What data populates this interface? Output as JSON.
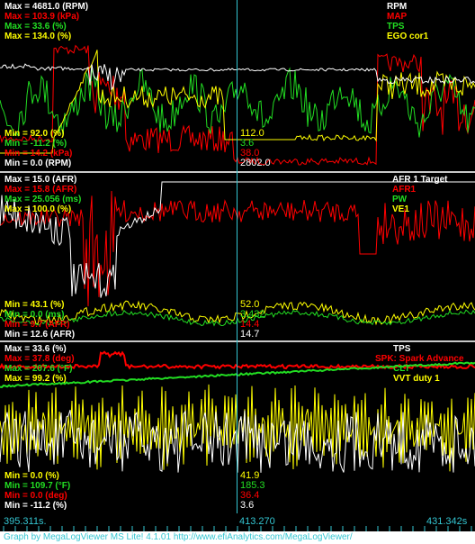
{
  "colors": {
    "white": "#ffffff",
    "red": "#ff0000",
    "green": "#22dd22",
    "yellow": "#ffff00",
    "cyan": "#34c6d2",
    "divider": "#c8c8c8"
  },
  "panel1": {
    "max_labels": [
      {
        "text": "Max = 4681.0 (RPM)",
        "color": "white"
      },
      {
        "text": "Max = 103.9 (kPa)",
        "color": "red"
      },
      {
        "text": "Max = 33.6 (%)",
        "color": "green"
      },
      {
        "text": "Max = 134.0 (%)",
        "color": "yellow"
      }
    ],
    "legend": [
      {
        "text": "RPM",
        "color": "white"
      },
      {
        "text": "MAP",
        "color": "red"
      },
      {
        "text": "TPS",
        "color": "green"
      },
      {
        "text": "EGO cor1",
        "color": "yellow"
      }
    ],
    "min_labels": [
      {
        "text": "Min = 92.0 (%)",
        "color": "yellow"
      },
      {
        "text": "Min = -11.2 (%)",
        "color": "green"
      },
      {
        "text": "Min = 14.2 (kPa)",
        "color": "red"
      },
      {
        "text": "Min = 0.0 (RPM)",
        "color": "white"
      }
    ],
    "cursor_values": [
      {
        "text": "112.0",
        "color": "yellow"
      },
      {
        "text": "3.6",
        "color": "green"
      },
      {
        "text": "38.0",
        "color": "red"
      },
      {
        "text": "2802.0",
        "color": "white"
      }
    ]
  },
  "panel2": {
    "max_labels": [
      {
        "text": "Max = 15.0 (AFR)",
        "color": "white"
      },
      {
        "text": "Max = 15.8 (AFR)",
        "color": "red"
      },
      {
        "text": "Max = 25.056 (ms)",
        "color": "green"
      },
      {
        "text": "Max = 100.0 (%)",
        "color": "yellow"
      }
    ],
    "legend": [
      {
        "text": "AFR 1 Target",
        "color": "white"
      },
      {
        "text": "AFR1",
        "color": "red"
      },
      {
        "text": "PW",
        "color": "green"
      },
      {
        "text": "VE1",
        "color": "yellow"
      }
    ],
    "min_labels": [
      {
        "text": "Min = 43.1 (%)",
        "color": "yellow"
      },
      {
        "text": "Min = 0.0 (ms)",
        "color": "green"
      },
      {
        "text": "Min = 9.7 (AFR)",
        "color": "red"
      },
      {
        "text": "Min = 12.6 (AFR)",
        "color": "white"
      }
    ],
    "cursor_values": [
      {
        "text": "52.0",
        "color": "yellow"
      },
      {
        "text": "3.432",
        "color": "green"
      },
      {
        "text": "14.4",
        "color": "red"
      },
      {
        "text": "14.7",
        "color": "white"
      }
    ]
  },
  "panel3": {
    "max_labels": [
      {
        "text": "Max = 33.6 (%)",
        "color": "white"
      },
      {
        "text": "Max = 37.8 (deg)",
        "color": "red"
      },
      {
        "text": "Max = 207.6 (°F)",
        "color": "green"
      },
      {
        "text": "Max = 99.2 (%)",
        "color": "yellow"
      }
    ],
    "legend": [
      {
        "text": "TPS",
        "color": "white"
      },
      {
        "text": "SPK: Spark Advance",
        "color": "red"
      },
      {
        "text": "CLT",
        "color": "green"
      },
      {
        "text": "VVT duty 1",
        "color": "yellow"
      }
    ],
    "min_labels": [
      {
        "text": "Min = 0.0 (%)",
        "color": "yellow"
      },
      {
        "text": "Min = 109.7 (°F)",
        "color": "green"
      },
      {
        "text": "Min = 0.0 (deg)",
        "color": "red"
      },
      {
        "text": "Min = -11.2 (%)",
        "color": "white"
      }
    ],
    "cursor_values": [
      {
        "text": "41.9",
        "color": "yellow"
      },
      {
        "text": "185.3",
        "color": "green"
      },
      {
        "text": "36.4",
        "color": "red"
      },
      {
        "text": "3.6",
        "color": "white"
      }
    ]
  },
  "timeline": {
    "start": "395.311s.",
    "cursor": "413.270",
    "end": "431.342s"
  },
  "status": {
    "text": "Graph by MegaLogViewer MS Lite! 4.1.01 http://www.efiAnalytics.com/MegaLogViewer/"
  }
}
